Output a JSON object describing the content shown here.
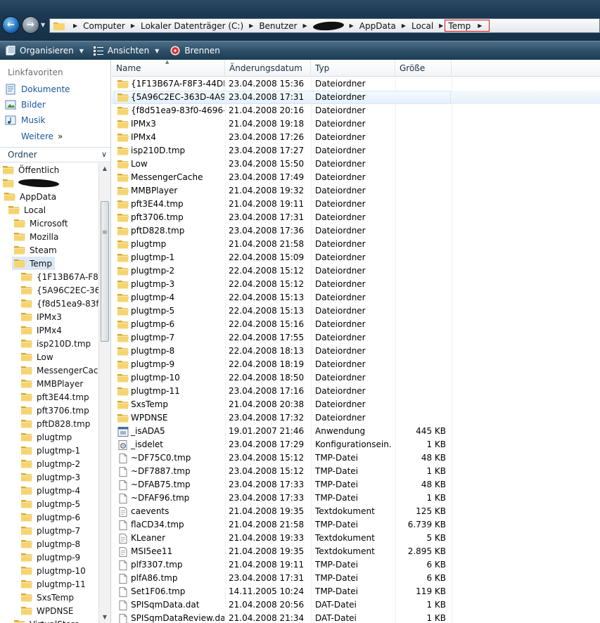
{
  "address": {
    "crumbs": [
      "Computer",
      "Lokaler Datenträger (C:)",
      "Benutzer",
      "",
      "AppData",
      "Local"
    ],
    "current": "Temp"
  },
  "toolbar": {
    "organize_label": "Organisieren",
    "views_label": "Ansichten",
    "burn_label": "Brennen"
  },
  "nav": {
    "favorites_title": "Linkfavoriten",
    "favorites": [
      "Dokumente",
      "Bilder",
      "Musik"
    ],
    "more_label": "Weitere",
    "more_arrows": "»",
    "folder_header": "Ordner",
    "tree": [
      {
        "label": "Öffentlich",
        "level": 0
      },
      {
        "label": "",
        "level": 0
      },
      {
        "label": "AppData",
        "level": 1
      },
      {
        "label": "Local",
        "level": 2
      },
      {
        "label": "Microsoft",
        "level": 3
      },
      {
        "label": "Mozilla",
        "level": 3
      },
      {
        "label": "Steam",
        "level": 3
      },
      {
        "label": "Temp",
        "level": 3,
        "selected": true
      },
      {
        "label": "{1F13B67A-F8F3-",
        "level": 4
      },
      {
        "label": "{5A96C2EC-363D",
        "level": 4
      },
      {
        "label": "{f8d51ea9-83f0-4",
        "level": 4
      },
      {
        "label": "IPMx3",
        "level": 4
      },
      {
        "label": "IPMx4",
        "level": 4
      },
      {
        "label": "isp210D.tmp",
        "level": 4
      },
      {
        "label": "Low",
        "level": 4
      },
      {
        "label": "MessengerCache",
        "level": 4
      },
      {
        "label": "MMBPlayer",
        "level": 4
      },
      {
        "label": "pft3E44.tmp",
        "level": 4
      },
      {
        "label": "pft3706.tmp",
        "level": 4
      },
      {
        "label": "pftD828.tmp",
        "level": 4
      },
      {
        "label": "plugtmp",
        "level": 4
      },
      {
        "label": "plugtmp-1",
        "level": 4
      },
      {
        "label": "plugtmp-2",
        "level": 4
      },
      {
        "label": "plugtmp-3",
        "level": 4
      },
      {
        "label": "plugtmp-4",
        "level": 4
      },
      {
        "label": "plugtmp-5",
        "level": 4
      },
      {
        "label": "plugtmp-6",
        "level": 4
      },
      {
        "label": "plugtmp-7",
        "level": 4
      },
      {
        "label": "plugtmp-8",
        "level": 4
      },
      {
        "label": "plugtmp-9",
        "level": 4
      },
      {
        "label": "plugtmp-10",
        "level": 4
      },
      {
        "label": "plugtmp-11",
        "level": 4
      },
      {
        "label": "SxsTemp",
        "level": 4
      },
      {
        "label": "WPDNSE",
        "level": 4
      },
      {
        "label": "VirtualStore",
        "level": 3
      }
    ]
  },
  "columns": {
    "name": "Name",
    "date": "Änderungsdatum",
    "type": "Typ",
    "size": "Größe"
  },
  "files": [
    {
      "name": "{1F13B67A-F8F3-44DB-...",
      "date": "23.04.2008 15:36",
      "type": "Dateiordner",
      "size": "",
      "icon": "folder"
    },
    {
      "name": "{5A96C2EC-363D-4A99...",
      "date": "23.04.2008 17:31",
      "type": "Dateiordner",
      "size": "",
      "icon": "folder",
      "hover": true
    },
    {
      "name": "{f8d51ea9-83f0-4696-8...",
      "date": "21.04.2008 20:16",
      "type": "Dateiordner",
      "size": "",
      "icon": "folder"
    },
    {
      "name": "IPMx3",
      "date": "21.04.2008 19:18",
      "type": "Dateiordner",
      "size": "",
      "icon": "folder"
    },
    {
      "name": "IPMx4",
      "date": "23.04.2008 17:26",
      "type": "Dateiordner",
      "size": "",
      "icon": "folder"
    },
    {
      "name": "isp210D.tmp",
      "date": "23.04.2008 17:27",
      "type": "Dateiordner",
      "size": "",
      "icon": "folder"
    },
    {
      "name": "Low",
      "date": "23.04.2008 15:50",
      "type": "Dateiordner",
      "size": "",
      "icon": "folder"
    },
    {
      "name": "MessengerCache",
      "date": "23.04.2008 17:49",
      "type": "Dateiordner",
      "size": "",
      "icon": "folder"
    },
    {
      "name": "MMBPlayer",
      "date": "21.04.2008 19:32",
      "type": "Dateiordner",
      "size": "",
      "icon": "folder"
    },
    {
      "name": "pft3E44.tmp",
      "date": "21.04.2008 19:11",
      "type": "Dateiordner",
      "size": "",
      "icon": "folder"
    },
    {
      "name": "pft3706.tmp",
      "date": "23.04.2008 17:31",
      "type": "Dateiordner",
      "size": "",
      "icon": "folder"
    },
    {
      "name": "pftD828.tmp",
      "date": "23.04.2008 17:36",
      "type": "Dateiordner",
      "size": "",
      "icon": "folder"
    },
    {
      "name": "plugtmp",
      "date": "21.04.2008 21:58",
      "type": "Dateiordner",
      "size": "",
      "icon": "folder"
    },
    {
      "name": "plugtmp-1",
      "date": "22.04.2008 15:09",
      "type": "Dateiordner",
      "size": "",
      "icon": "folder"
    },
    {
      "name": "plugtmp-2",
      "date": "22.04.2008 15:12",
      "type": "Dateiordner",
      "size": "",
      "icon": "folder"
    },
    {
      "name": "plugtmp-3",
      "date": "22.04.2008 15:12",
      "type": "Dateiordner",
      "size": "",
      "icon": "folder"
    },
    {
      "name": "plugtmp-4",
      "date": "22.04.2008 15:13",
      "type": "Dateiordner",
      "size": "",
      "icon": "folder"
    },
    {
      "name": "plugtmp-5",
      "date": "22.04.2008 15:13",
      "type": "Dateiordner",
      "size": "",
      "icon": "folder"
    },
    {
      "name": "plugtmp-6",
      "date": "22.04.2008 15:16",
      "type": "Dateiordner",
      "size": "",
      "icon": "folder"
    },
    {
      "name": "plugtmp-7",
      "date": "22.04.2008 17:55",
      "type": "Dateiordner",
      "size": "",
      "icon": "folder"
    },
    {
      "name": "plugtmp-8",
      "date": "22.04.2008 18:13",
      "type": "Dateiordner",
      "size": "",
      "icon": "folder"
    },
    {
      "name": "plugtmp-9",
      "date": "22.04.2008 18:19",
      "type": "Dateiordner",
      "size": "",
      "icon": "folder"
    },
    {
      "name": "plugtmp-10",
      "date": "22.04.2008 18:50",
      "type": "Dateiordner",
      "size": "",
      "icon": "folder"
    },
    {
      "name": "plugtmp-11",
      "date": "23.04.2008 17:16",
      "type": "Dateiordner",
      "size": "",
      "icon": "folder"
    },
    {
      "name": "SxsTemp",
      "date": "21.04.2008 20:38",
      "type": "Dateiordner",
      "size": "",
      "icon": "folder"
    },
    {
      "name": "WPDNSE",
      "date": "23.04.2008 17:32",
      "type": "Dateiordner",
      "size": "",
      "icon": "folder"
    },
    {
      "name": "_isADA5",
      "date": "19.01.2007 21:46",
      "type": "Anwendung",
      "size": "445 KB",
      "icon": "app"
    },
    {
      "name": "_isdelet",
      "date": "23.04.2008 17:29",
      "type": "Konfigurationsein...",
      "size": "1 KB",
      "icon": "config"
    },
    {
      "name": "~DF75C0.tmp",
      "date": "23.04.2008 15:12",
      "type": "TMP-Datei",
      "size": "48 KB",
      "icon": "file"
    },
    {
      "name": "~DF7887.tmp",
      "date": "23.04.2008 15:12",
      "type": "TMP-Datei",
      "size": "1 KB",
      "icon": "file"
    },
    {
      "name": "~DFAB75.tmp",
      "date": "23.04.2008 17:33",
      "type": "TMP-Datei",
      "size": "48 KB",
      "icon": "file"
    },
    {
      "name": "~DFAF96.tmp",
      "date": "23.04.2008 17:33",
      "type": "TMP-Datei",
      "size": "1 KB",
      "icon": "file"
    },
    {
      "name": "caevents",
      "date": "21.04.2008 19:35",
      "type": "Textdokument",
      "size": "125 KB",
      "icon": "text"
    },
    {
      "name": "flaCD34.tmp",
      "date": "21.04.2008 21:58",
      "type": "TMP-Datei",
      "size": "6.739 KB",
      "icon": "file"
    },
    {
      "name": "KLeaner",
      "date": "21.04.2008 19:33",
      "type": "Textdokument",
      "size": "5 KB",
      "icon": "text"
    },
    {
      "name": "MSI5ee11",
      "date": "21.04.2008 19:35",
      "type": "Textdokument",
      "size": "2.895 KB",
      "icon": "text"
    },
    {
      "name": "plf3307.tmp",
      "date": "21.04.2008 19:11",
      "type": "TMP-Datei",
      "size": "6 KB",
      "icon": "file"
    },
    {
      "name": "plfA86.tmp",
      "date": "23.04.2008 17:31",
      "type": "TMP-Datei",
      "size": "6 KB",
      "icon": "file"
    },
    {
      "name": "Set1F06.tmp",
      "date": "14.11.2005 10:24",
      "type": "TMP-Datei",
      "size": "119 KB",
      "icon": "file"
    },
    {
      "name": "SPISqmData.dat",
      "date": "21.04.2008 20:56",
      "type": "DAT-Datei",
      "size": "1 KB",
      "icon": "file"
    },
    {
      "name": "SPISqmDataReview.dat",
      "date": "21.04.2008 21:34",
      "type": "DAT-Datei",
      "size": "1 KB",
      "icon": "file"
    }
  ]
}
